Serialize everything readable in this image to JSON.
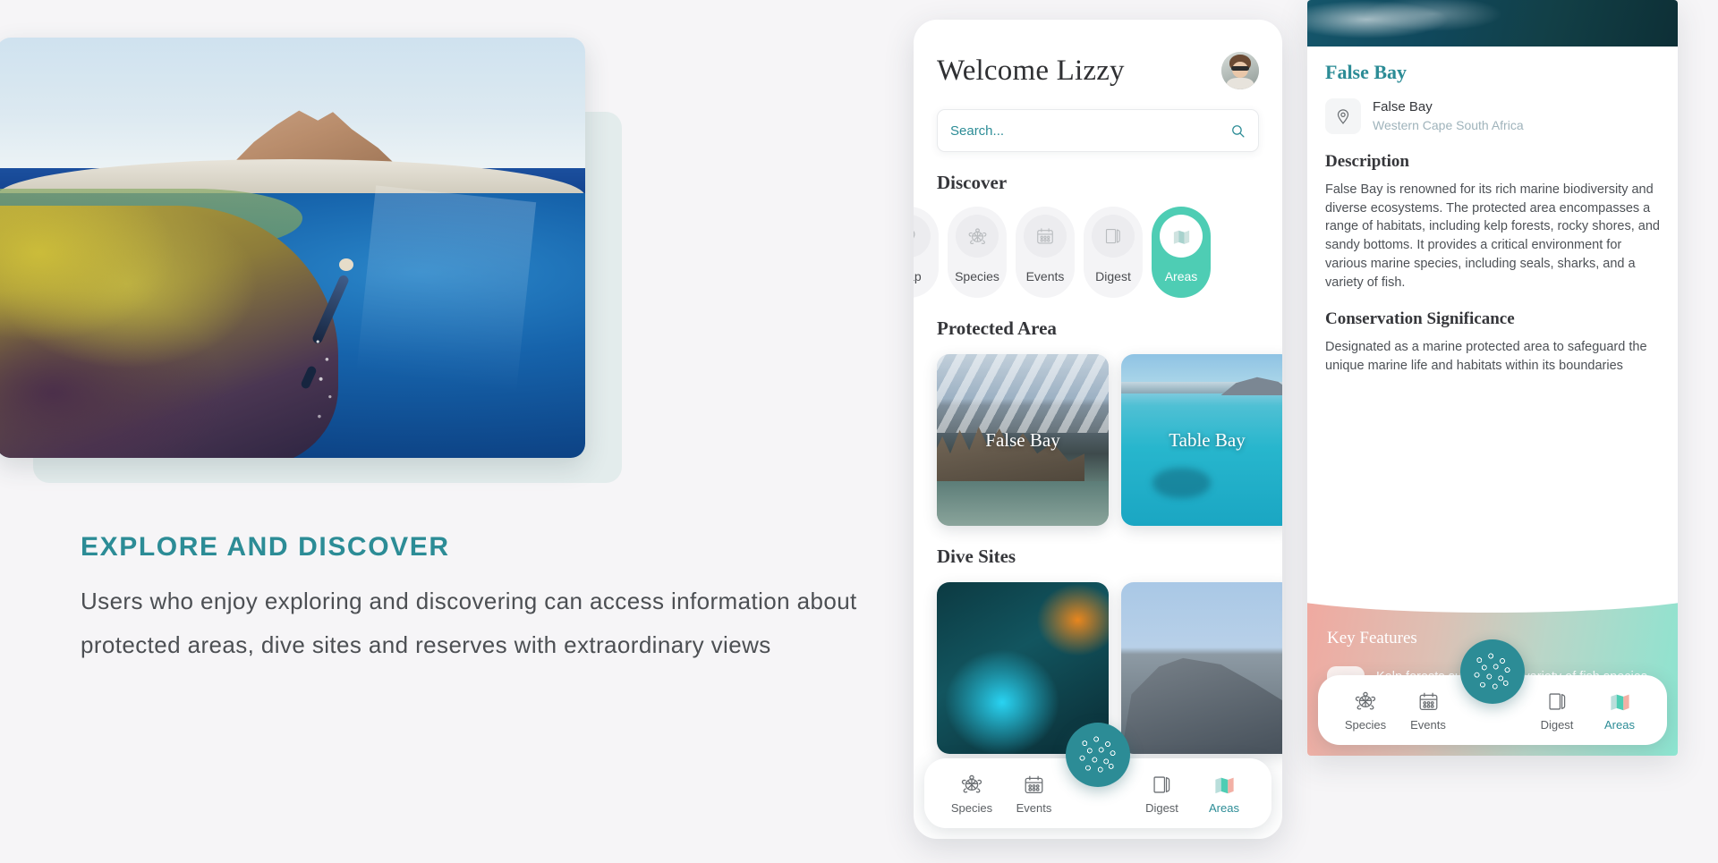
{
  "promo": {
    "title": "EXPLORE AND DISCOVER",
    "body": "Users who enjoy exploring and discovering can access information about protected areas, dive sites and reserves with extraordinary views",
    "accent_color": "#2c8c96",
    "hero_alt": "over-under split photo of coral reef and freediver"
  },
  "home": {
    "greeting": "Welcome Lizzy",
    "avatar_alt": "user profile photo",
    "search": {
      "value": "",
      "placeholder": "Search...",
      "icon": "search-icon"
    },
    "discover": {
      "heading": "Discover",
      "items": [
        {
          "label": "Map",
          "icon": "map-pin-icon",
          "active": false,
          "clipped": true
        },
        {
          "label": "Species",
          "icon": "turtle-icon",
          "active": false
        },
        {
          "label": "Events",
          "icon": "calendar-icon",
          "active": false
        },
        {
          "label": "Digest",
          "icon": "book-icon",
          "active": false
        },
        {
          "label": "Areas",
          "icon": "folded-map-icon",
          "active": true
        }
      ]
    },
    "protected_area": {
      "heading": "Protected Area",
      "cards": [
        {
          "caption": "False Bay"
        },
        {
          "caption": "Table Bay"
        }
      ]
    },
    "dive_sites": {
      "heading": "Dive Sites",
      "cards": [
        {
          "caption": ""
        },
        {
          "caption": ""
        }
      ]
    }
  },
  "detail": {
    "title": "False Bay",
    "location": {
      "name": "False Bay",
      "region": "Western Cape South Africa",
      "icon": "location-pin-icon"
    },
    "sections": [
      {
        "heading": "Description",
        "text": "False Bay is renowned for its rich marine biodiversity and diverse ecosystems. The protected area encompasses a range of habitats, including kelp forests, rocky shores, and sandy bottoms. It provides a critical environment for various marine species, including seals, sharks, and a variety of fish."
      },
      {
        "heading": "Conservation Significance",
        "text": "Designated as a marine protected area to safeguard the unique marine life and habitats within its boundaries"
      }
    ],
    "key_features": {
      "heading": "Key Features",
      "items": [
        {
          "text": "Kelp forests supporting a variety of fish species",
          "icon": "kelp-icon"
        }
      ],
      "gradient_from": "#f0a9a0",
      "gradient_to": "#8ce4d0"
    }
  },
  "bottom_nav": {
    "items": [
      {
        "label": "Species",
        "icon": "turtle-icon",
        "active": false
      },
      {
        "label": "Events",
        "icon": "calendar-icon",
        "active": false
      },
      {
        "label": "Digest",
        "icon": "book-icon",
        "active": false
      },
      {
        "label": "Areas",
        "icon": "folded-map-color-icon",
        "active": true
      }
    ],
    "fab": {
      "icon": "bubbles-icon",
      "color": "#2c8c96"
    },
    "active_color": "#2c8c96"
  }
}
